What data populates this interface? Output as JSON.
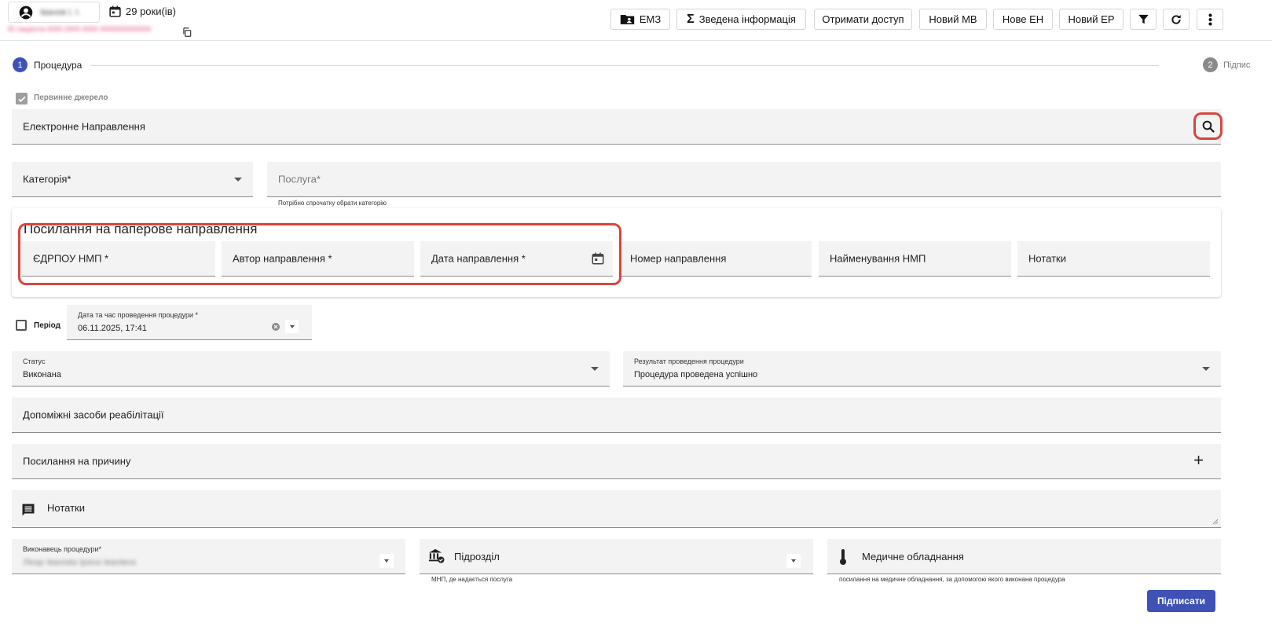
{
  "patient": {
    "name": "Іванов І. І.",
    "age_label": "29 роки(ів)",
    "id_line": "ID пацієнта 0000 0000 0000 0000000000000"
  },
  "toolbar": {
    "emz": "ЕМЗ",
    "summary": "Зведена інформація",
    "access": "Отримати доступ",
    "new_mv": "Новий МВ",
    "new_en": "Нове ЕН",
    "new_ep": "Новий ЕР"
  },
  "stepper": {
    "step1_num": "1",
    "step1_label": "Процедура",
    "step2_num": "2",
    "step2_label": "Підпис"
  },
  "primary_source_label": "Первинне джерело",
  "referral_field": "Електронне Направлення",
  "category_label": "Категорія*",
  "service_label": "Послуга*",
  "service_hint": "Потрібно спрочатку обрати категорію",
  "paper_ref": {
    "title": "Посилання на паперове направлення",
    "edrpou": "ЄДРПОУ НМП *",
    "author": "Автор направлення *",
    "date": "Дата направлення *",
    "number": "Номер направлення",
    "org_name": "Найменування НМП",
    "notes": "Нотатки"
  },
  "period_label": "Період",
  "datetime": {
    "label": "Дата та час проведення процедури *",
    "value": "06.11.2025, 17:41"
  },
  "status": {
    "label": "Статус",
    "value": "Виконана"
  },
  "result": {
    "label": "Результат проведення процедури",
    "value": "Процедура проведена успішно"
  },
  "rehab_label": "Допоміжні засоби реабілітації",
  "reason_label": "Посилання на причину",
  "notes_label": "Нотатки",
  "performer": {
    "label": "Виконавець процедури*",
    "value": "Лікар Іванова Ірина Іванівна"
  },
  "department": {
    "label": "Підрозділ",
    "hint": "МНП, де надається послуга"
  },
  "equipment": {
    "label": "Медичне обладнання",
    "hint": "посилання на медичне обладнання, за допомогою якого виконана процедура"
  },
  "sign_button": "Підписати",
  "colors": {
    "accent": "#3f51b5",
    "highlight": "#d9453c",
    "field_bg": "#f3f3f3"
  }
}
